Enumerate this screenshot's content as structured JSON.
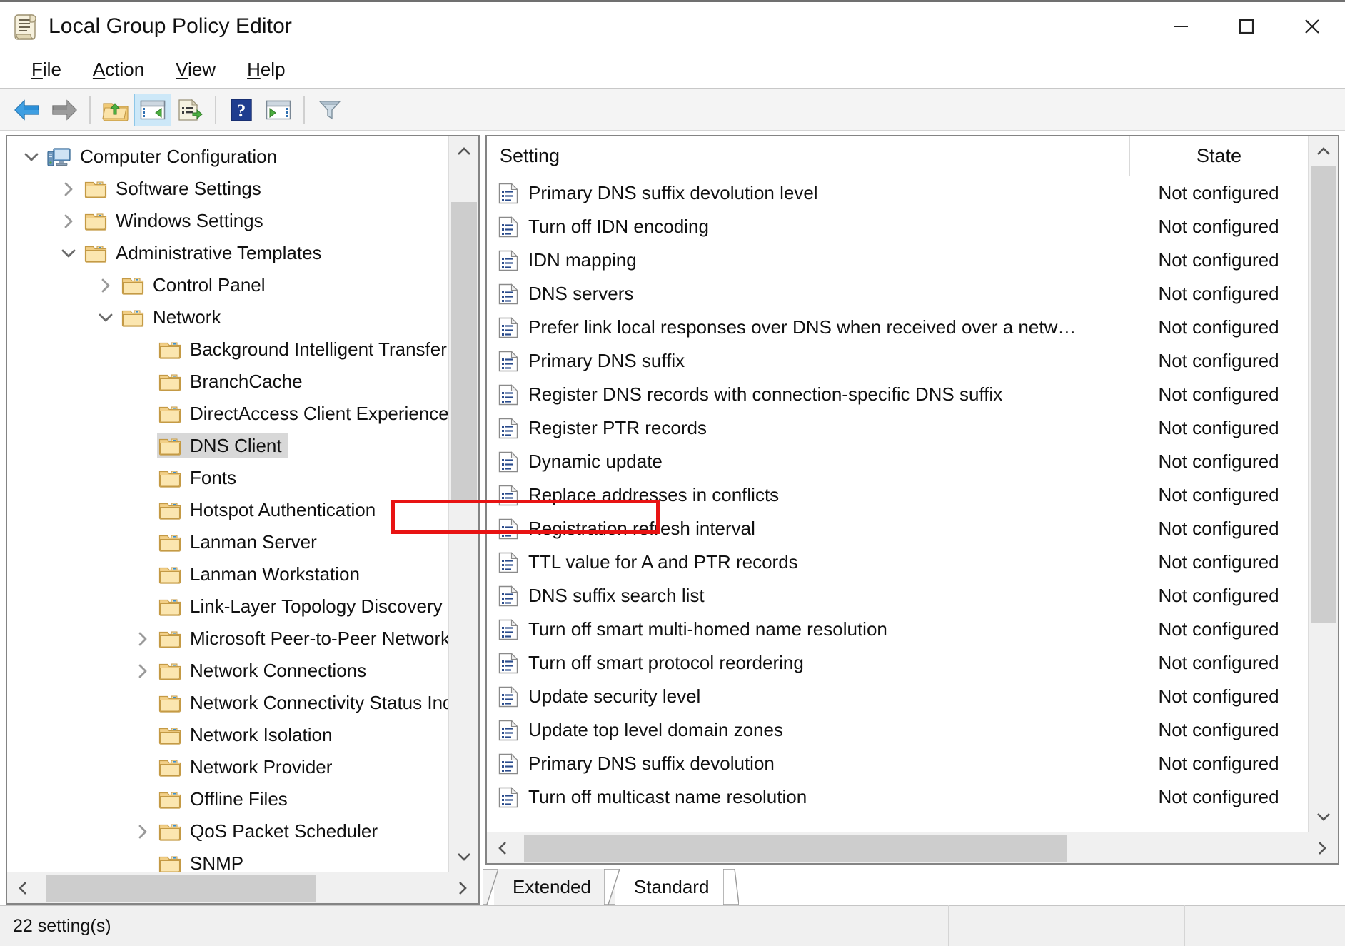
{
  "window": {
    "title": "Local Group Policy Editor",
    "icon": "policy-scroll-icon",
    "controls": {
      "minimize": "minimize-icon",
      "maximize": "maximize-icon",
      "close": "close-icon"
    }
  },
  "menubar": {
    "items": [
      {
        "label": "File",
        "accel": "F"
      },
      {
        "label": "Action",
        "accel": "A"
      },
      {
        "label": "View",
        "accel": "V"
      },
      {
        "label": "Help",
        "accel": "H"
      }
    ]
  },
  "toolbar": {
    "buttons": [
      {
        "name": "back-arrow-icon",
        "enabled": true,
        "active": false
      },
      {
        "name": "forward-arrow-icon",
        "enabled": false,
        "active": false
      },
      {
        "name": "up-one-level-folder-icon",
        "enabled": true,
        "active": false
      },
      {
        "name": "show-hide-console-tree-icon",
        "enabled": true,
        "active": true
      },
      {
        "name": "export-list-icon",
        "enabled": true,
        "active": false
      },
      {
        "name": "help-icon",
        "enabled": true,
        "active": false
      },
      {
        "name": "show-hide-action-pane-icon",
        "enabled": true,
        "active": false
      },
      {
        "name": "filter-icon",
        "enabled": true,
        "active": false
      }
    ]
  },
  "tree": {
    "nodes": [
      {
        "label": "Computer Configuration",
        "depth": 0,
        "twist": "down",
        "icon": "computer-icon",
        "selected": false
      },
      {
        "label": "Software Settings",
        "depth": 1,
        "twist": "right",
        "icon": "folder-icon",
        "selected": false
      },
      {
        "label": "Windows Settings",
        "depth": 1,
        "twist": "right",
        "icon": "folder-icon",
        "selected": false
      },
      {
        "label": "Administrative Templates",
        "depth": 1,
        "twist": "down",
        "icon": "folder-icon",
        "selected": false
      },
      {
        "label": "Control Panel",
        "depth": 2,
        "twist": "right",
        "icon": "folder-icon",
        "selected": false
      },
      {
        "label": "Network",
        "depth": 2,
        "twist": "down",
        "icon": "folder-icon",
        "selected": false
      },
      {
        "label": "Background Intelligent Transfer Service",
        "depth": 3,
        "twist": "none",
        "icon": "folder-icon",
        "selected": false
      },
      {
        "label": "BranchCache",
        "depth": 3,
        "twist": "none",
        "icon": "folder-icon",
        "selected": false
      },
      {
        "label": "DirectAccess Client Experience Settings",
        "depth": 3,
        "twist": "none",
        "icon": "folder-icon",
        "selected": false
      },
      {
        "label": "DNS Client",
        "depth": 3,
        "twist": "none",
        "icon": "folder-icon",
        "selected": true
      },
      {
        "label": "Fonts",
        "depth": 3,
        "twist": "none",
        "icon": "folder-icon",
        "selected": false
      },
      {
        "label": "Hotspot Authentication",
        "depth": 3,
        "twist": "none",
        "icon": "folder-icon",
        "selected": false
      },
      {
        "label": "Lanman Server",
        "depth": 3,
        "twist": "none",
        "icon": "folder-icon",
        "selected": false
      },
      {
        "label": "Lanman Workstation",
        "depth": 3,
        "twist": "none",
        "icon": "folder-icon",
        "selected": false
      },
      {
        "label": "Link-Layer Topology Discovery",
        "depth": 3,
        "twist": "none",
        "icon": "folder-icon",
        "selected": false
      },
      {
        "label": "Microsoft Peer-to-Peer Networking Services",
        "depth": 3,
        "twist": "right",
        "icon": "folder-icon",
        "selected": false
      },
      {
        "label": "Network Connections",
        "depth": 3,
        "twist": "right",
        "icon": "folder-icon",
        "selected": false
      },
      {
        "label": "Network Connectivity Status Indicator",
        "depth": 3,
        "twist": "none",
        "icon": "folder-icon",
        "selected": false
      },
      {
        "label": "Network Isolation",
        "depth": 3,
        "twist": "none",
        "icon": "folder-icon",
        "selected": false
      },
      {
        "label": "Network Provider",
        "depth": 3,
        "twist": "none",
        "icon": "folder-icon",
        "selected": false
      },
      {
        "label": "Offline Files",
        "depth": 3,
        "twist": "none",
        "icon": "folder-icon",
        "selected": false
      },
      {
        "label": "QoS Packet Scheduler",
        "depth": 3,
        "twist": "right",
        "icon": "folder-icon",
        "selected": false
      },
      {
        "label": "SNMP",
        "depth": 3,
        "twist": "none",
        "icon": "folder-icon",
        "selected": false
      }
    ]
  },
  "list": {
    "columns": {
      "setting": "Setting",
      "state": "State"
    },
    "rows": [
      {
        "setting": "Primary DNS suffix devolution level",
        "state": "Not configured",
        "highlighted": false
      },
      {
        "setting": "Turn off IDN encoding",
        "state": "Not configured",
        "highlighted": false
      },
      {
        "setting": "IDN mapping",
        "state": "Not configured",
        "highlighted": false
      },
      {
        "setting": "DNS servers",
        "state": "Not configured",
        "highlighted": false
      },
      {
        "setting": "Prefer link local responses over DNS when received over a netw…",
        "state": "Not configured",
        "highlighted": false
      },
      {
        "setting": "Primary DNS suffix",
        "state": "Not configured",
        "highlighted": false
      },
      {
        "setting": "Register DNS records with connection-specific DNS suffix",
        "state": "Not configured",
        "highlighted": false
      },
      {
        "setting": "Register PTR records",
        "state": "Not configured",
        "highlighted": false
      },
      {
        "setting": "Dynamic update",
        "state": "Not configured",
        "highlighted": false
      },
      {
        "setting": "Replace addresses in conflicts",
        "state": "Not configured",
        "highlighted": false
      },
      {
        "setting": "Registration refresh interval",
        "state": "Not configured",
        "highlighted": false
      },
      {
        "setting": "TTL value for A and PTR records",
        "state": "Not configured",
        "highlighted": false
      },
      {
        "setting": "DNS suffix search list",
        "state": "Not configured",
        "highlighted": true
      },
      {
        "setting": "Turn off smart multi-homed name resolution",
        "state": "Not configured",
        "highlighted": false
      },
      {
        "setting": "Turn off smart protocol reordering",
        "state": "Not configured",
        "highlighted": false
      },
      {
        "setting": "Update security level",
        "state": "Not configured",
        "highlighted": false
      },
      {
        "setting": "Update top level domain zones",
        "state": "Not configured",
        "highlighted": false
      },
      {
        "setting": "Primary DNS suffix devolution",
        "state": "Not configured",
        "highlighted": false
      },
      {
        "setting": "Turn off multicast name resolution",
        "state": "Not configured",
        "highlighted": false
      }
    ]
  },
  "tabs": {
    "items": [
      {
        "label": "Extended",
        "active": false
      },
      {
        "label": "Standard",
        "active": true
      }
    ]
  },
  "statusbar": {
    "text": "22 setting(s)"
  },
  "colors": {
    "annotation": "#e81313",
    "selection": "#d8d8d8",
    "toolbar_active": "#cde8f8",
    "folder": "#f5d99b",
    "pane_border": "#848484"
  }
}
